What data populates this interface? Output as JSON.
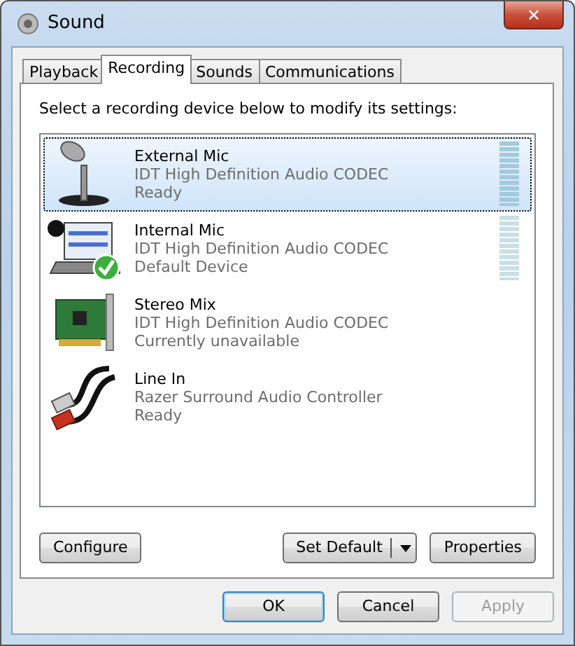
{
  "window": {
    "title": "Sound",
    "close": "✕"
  },
  "tabs": [
    {
      "label": "Playback",
      "selected": false
    },
    {
      "label": "Recording",
      "selected": true
    },
    {
      "label": "Sounds",
      "selected": false
    },
    {
      "label": "Communications",
      "selected": false
    }
  ],
  "instruction": "Select a recording device below to modify its settings:",
  "devices": [
    {
      "kind": "external-mic",
      "name": "External Mic",
      "driver": "IDT High Definition Audio CODEC",
      "status": "Ready",
      "selected": true,
      "default": false,
      "meter": true
    },
    {
      "kind": "internal-mic",
      "name": "Internal Mic",
      "driver": "IDT High Definition Audio CODEC",
      "status": "Default Device",
      "selected": false,
      "default": true,
      "meter": true
    },
    {
      "kind": "sound-card",
      "name": "Stereo Mix",
      "driver": "IDT High Definition Audio CODEC",
      "status": "Currently unavailable",
      "selected": false,
      "default": false,
      "meter": false
    },
    {
      "kind": "line-in",
      "name": "Line In",
      "driver": "Razer Surround Audio Controller",
      "status": "Ready",
      "selected": false,
      "default": false,
      "meter": false
    }
  ],
  "device_buttons": [
    {
      "label": "Configure",
      "kind": "plain"
    },
    {
      "label": "Set Default",
      "kind": "split"
    },
    {
      "label": "Properties",
      "kind": "plain"
    }
  ],
  "dialog_buttons": [
    {
      "label": "OK",
      "disabled": false,
      "default": true
    },
    {
      "label": "Cancel",
      "disabled": false,
      "default": false
    },
    {
      "label": "Apply",
      "disabled": true,
      "default": false
    }
  ]
}
